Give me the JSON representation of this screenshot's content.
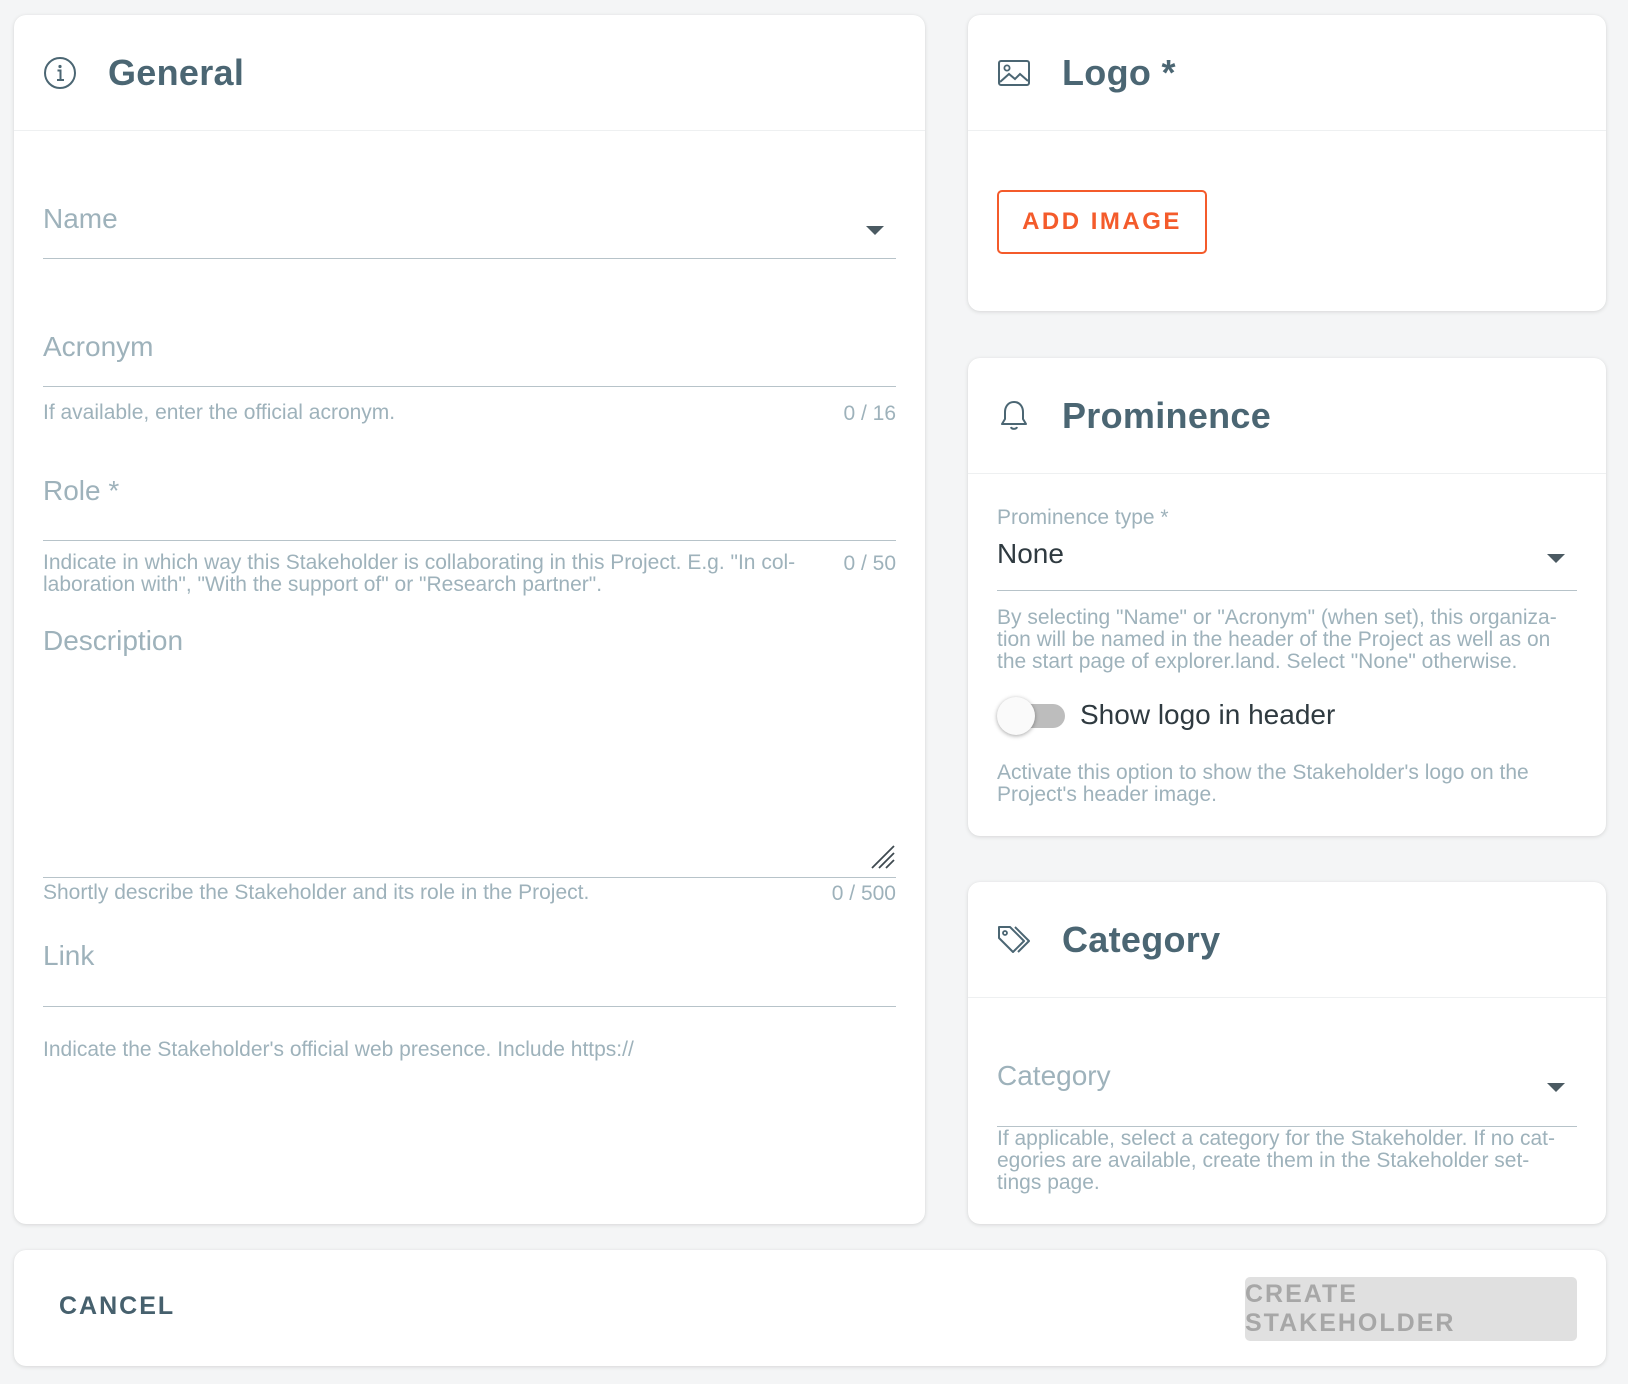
{
  "general": {
    "title": "General",
    "name": {
      "label": "Name"
    },
    "acronym": {
      "label": "Acronym",
      "hint": "If available, enter the official acronym.",
      "count": "0 / 16"
    },
    "role": {
      "label": "Role *",
      "hint_line1": "Indicate in which way this Stakeholder is collaborating in this Project. E.g. \"In col-",
      "hint_line2": "laboration with\", \"With the support of\" or \"Research partner\".",
      "count": "0 / 50"
    },
    "description": {
      "label": "Description",
      "hint": "Shortly describe the Stakeholder and its role in the Project.",
      "count": "0 / 500"
    },
    "link": {
      "label": "Link",
      "hint": "Indicate the Stakeholder's official web presence. Include https://"
    }
  },
  "logo": {
    "title": "Logo *",
    "add_image_label": "ADD IMAGE"
  },
  "prominence": {
    "title": "Prominence",
    "type_label": "Prominence type *",
    "type_value": "None",
    "type_hint_line1": "By selecting \"Name\" or \"Acronym\" (when set), this organiza-",
    "type_hint_line2": "tion will be named in the header of the Project as well as on",
    "type_hint_line3": "the start page of explorer.land. Select \"None\" otherwise.",
    "toggle_label": "Show logo in header",
    "toggle_on": false,
    "toggle_hint_line1": "Activate this option to show the Stakeholder's logo on the",
    "toggle_hint_line2": "Project's header image."
  },
  "category": {
    "title": "Category",
    "field_label": "Category",
    "hint_line1": "If applicable, select a category for the Stakeholder. If no cat-",
    "hint_line2": "egories are available, create them in the Stakeholder set-",
    "hint_line3": "tings page."
  },
  "footer": {
    "cancel_label": "CANCEL",
    "create_label": "CREATE STAKEHOLDER"
  },
  "colors": {
    "accent": "#f45b2b",
    "title_text": "#4b6673",
    "hint_text": "#9eb2bb",
    "disabled_button_bg": "#e0e0e0",
    "disabled_button_text": "#a7a7a7"
  }
}
